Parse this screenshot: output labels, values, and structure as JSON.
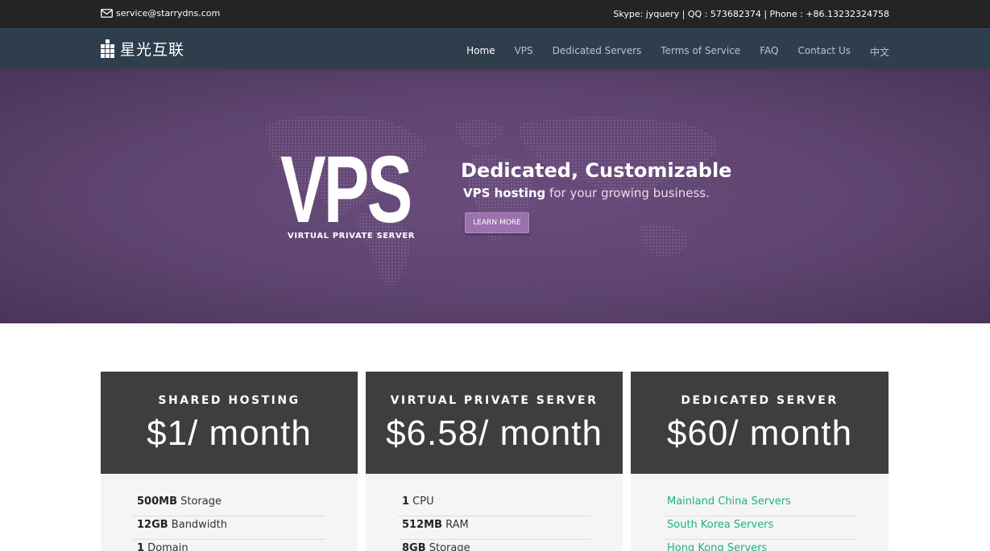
{
  "topbar": {
    "email": "service@starrydns.com",
    "contact": "Skype: jyquery | QQ : 573682374 | Phone : +86.13232324758",
    "email_icon": "envelope-icon"
  },
  "brand": {
    "logo_icon": "grid-logo-icon",
    "name": "星光互联"
  },
  "nav": {
    "items": [
      "Home",
      "VPS",
      "Dedicated Servers",
      "Terms of Service",
      "FAQ",
      "Contact Us",
      "中文"
    ],
    "active": "Home"
  },
  "hero": {
    "big_text": "VPS",
    "sub_text": "VIRTUAL PRIVATE SERVER",
    "title": "Dedicated, Customizable",
    "tag_bold": "VPS hosting",
    "tag_rest": " for your growing business.",
    "button": "LEARN MORE",
    "background_color": "#5e4470"
  },
  "plans": [
    {
      "name": "SHARED HOSTING",
      "price": "$1/ month",
      "features": [
        {
          "bold": "500MB",
          "text": " Storage"
        },
        {
          "bold": "12GB",
          "text": " Bandwidth"
        },
        {
          "bold": "1",
          "text": " Domain"
        }
      ]
    },
    {
      "name": "VIRTUAL PRIVATE SERVER",
      "price": "$6.58/ month",
      "features": [
        {
          "bold": "1",
          "text": " CPU"
        },
        {
          "bold": "512MB",
          "text": " RAM"
        },
        {
          "bold": "8GB",
          "text": " Storage"
        }
      ]
    },
    {
      "name": "DEDICATED SERVER",
      "price": "$60/ month",
      "links": [
        "Mainland China Servers",
        "South Korea Servers",
        "Hong Kong Servers"
      ]
    }
  ],
  "colors": {
    "topbar": "#242424",
    "navbar": "#2f3e4d",
    "plan_header": "#3e3e3e",
    "link": "#1fae8a",
    "button": "#9a72ad"
  }
}
